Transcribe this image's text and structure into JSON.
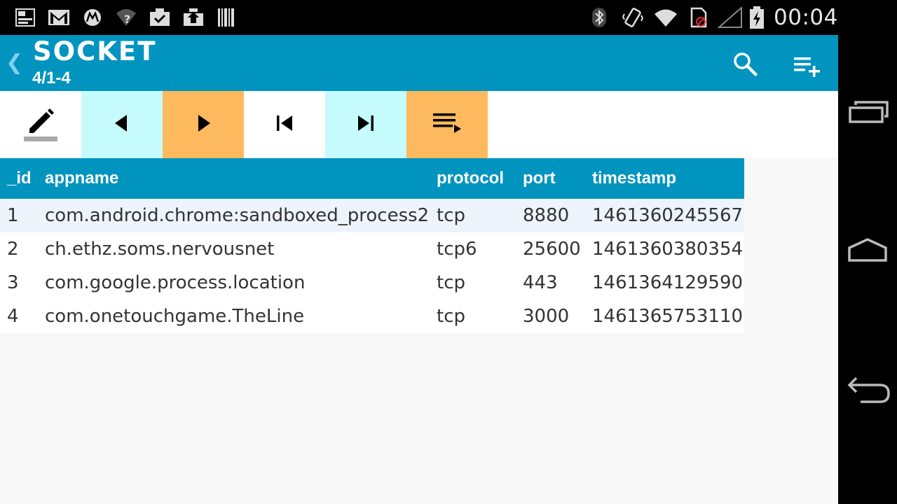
{
  "status_bar": {
    "time": "00:04",
    "left_icons": [
      "image-icon",
      "gmail-icon",
      "motorola-icon",
      "wifi-unknown-icon",
      "download-done-icon",
      "upload-icon",
      "barcode-icon"
    ],
    "right_icons": [
      "bluetooth-icon",
      "vibrate-icon",
      "wifi-icon",
      "no-sim-icon",
      "signal-icon",
      "battery-charging-icon"
    ]
  },
  "action_bar": {
    "title": "SOCKET",
    "subtitle": "4/1-4",
    "actions": [
      "search-icon",
      "add-to-list-icon"
    ]
  },
  "toolbar": {
    "buttons": [
      "edit-icon",
      "previous-icon",
      "next-icon",
      "first-icon",
      "last-icon",
      "playlist-play-icon"
    ]
  },
  "table": {
    "columns": [
      "_id",
      "appname",
      "protocol",
      "port",
      "timestamp"
    ],
    "rows": [
      [
        "1",
        "com.android.chrome:sandboxed_process2",
        "tcp",
        "8880",
        "1461360245567"
      ],
      [
        "2",
        "ch.ethz.soms.nervousnet",
        "tcp6",
        "25600",
        "1461360380354"
      ],
      [
        "3",
        "com.google.process.location",
        "tcp",
        "443",
        "1461364129590"
      ],
      [
        "4",
        "com.onetouchgame.TheLine",
        "tcp",
        "3000",
        "1461365753110"
      ]
    ]
  },
  "nav_bar": {
    "buttons": [
      "recent-apps-icon",
      "home-icon",
      "back-icon"
    ]
  },
  "colors": {
    "accent": "#0094bf",
    "cyan_button": "#c6fbfd",
    "orange_button": "#fdb95d",
    "row_alt": "#eef4fc"
  }
}
